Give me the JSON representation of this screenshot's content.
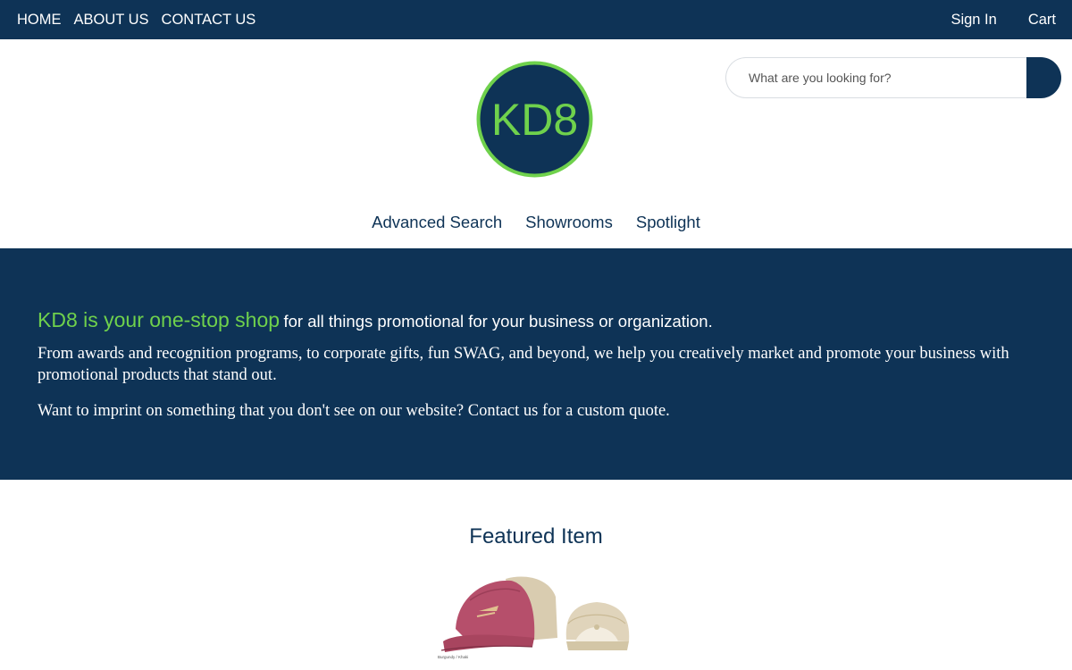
{
  "topbar": {
    "links": [
      "HOME",
      "ABOUT US",
      "CONTACT US"
    ],
    "sign_in": "Sign In",
    "cart": "Cart"
  },
  "logo": {
    "text": "KD8"
  },
  "search": {
    "placeholder": "What are you looking for?"
  },
  "subnav": [
    "Advanced Search",
    "Showrooms",
    "Spotlight"
  ],
  "hero": {
    "lead_green": "KD8 is your one-stop shop",
    "lead_rest": "for all things promotional for your business or organization.",
    "paragraph1": "From awards and recognition programs, to corporate gifts, fun SWAG, and beyond, we help you creatively market and promote your business with promotional products that stand out.",
    "paragraph2": "Want to imprint on something that you don't see on our website? Contact us for a custom quote."
  },
  "featured": {
    "title": "Featured Item",
    "product_caption": "Burgundy / Khaki"
  },
  "colors": {
    "navy": "#0e3356",
    "green": "#6fd14c",
    "white": "#ffffff"
  }
}
